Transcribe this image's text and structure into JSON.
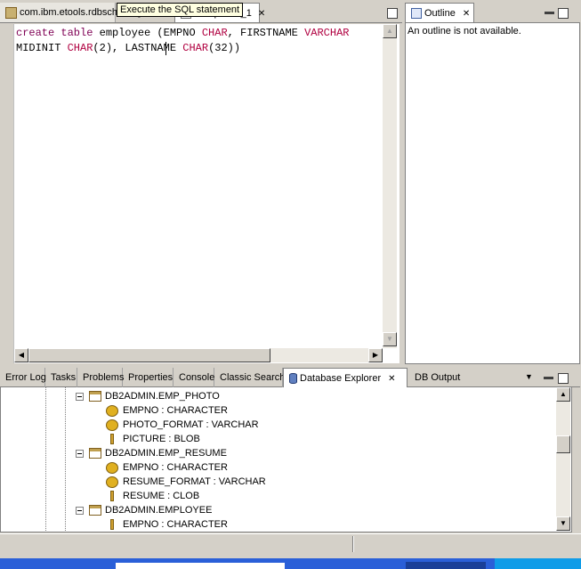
{
  "editor": {
    "tabs": [
      {
        "label": "com.ibm.etools.rdbschemagen"
      },
      {
        "label": "Scrapbook_1"
      }
    ],
    "tooltip": "Execute the SQL statement",
    "lines": [
      [
        {
          "t": "create table ",
          "c": "kw"
        },
        {
          "t": "employee (EMPNO ",
          "c": ""
        },
        {
          "t": "CHAR",
          "c": "ty"
        },
        {
          "t": ", FIRSTNAME ",
          "c": ""
        },
        {
          "t": "VARCHAR",
          "c": "ty"
        }
      ],
      [
        {
          "t": "MIDINIT ",
          "c": ""
        },
        {
          "t": "CHAR",
          "c": "ty"
        },
        {
          "t": "(2), LASTNAME ",
          "c": ""
        },
        {
          "t": "CHAR",
          "c": "ty"
        },
        {
          "t": "(32))",
          "c": ""
        }
      ]
    ]
  },
  "outline": {
    "tab_label": "Outline",
    "message": "An outline is not available."
  },
  "bottom": {
    "tabs": [
      {
        "label": "Error Log"
      },
      {
        "label": "Tasks"
      },
      {
        "label": "Problems"
      },
      {
        "label": "Properties"
      },
      {
        "label": "Console"
      },
      {
        "label": "Classic Search"
      },
      {
        "label": "Database Explorer",
        "active": true
      },
      {
        "label": "DB Output"
      }
    ],
    "tree": [
      {
        "label": "DB2ADMIN.EMP_PHOTO",
        "kind": "table",
        "level": 0
      },
      {
        "label": "EMPNO : CHARACTER",
        "kind": "key",
        "level": 1
      },
      {
        "label": "PHOTO_FORMAT : VARCHAR",
        "kind": "key",
        "level": 1
      },
      {
        "label": "PICTURE : BLOB",
        "kind": "col",
        "level": 1
      },
      {
        "label": "DB2ADMIN.EMP_RESUME",
        "kind": "table",
        "level": 0
      },
      {
        "label": "EMPNO : CHARACTER",
        "kind": "key",
        "level": 1
      },
      {
        "label": "RESUME_FORMAT : VARCHAR",
        "kind": "key",
        "level": 1
      },
      {
        "label": "RESUME : CLOB",
        "kind": "col",
        "level": 1
      },
      {
        "label": "DB2ADMIN.EMPLOYEE",
        "kind": "table",
        "level": 0
      },
      {
        "label": "EMPNO : CHARACTER",
        "kind": "col",
        "level": 1
      }
    ]
  }
}
